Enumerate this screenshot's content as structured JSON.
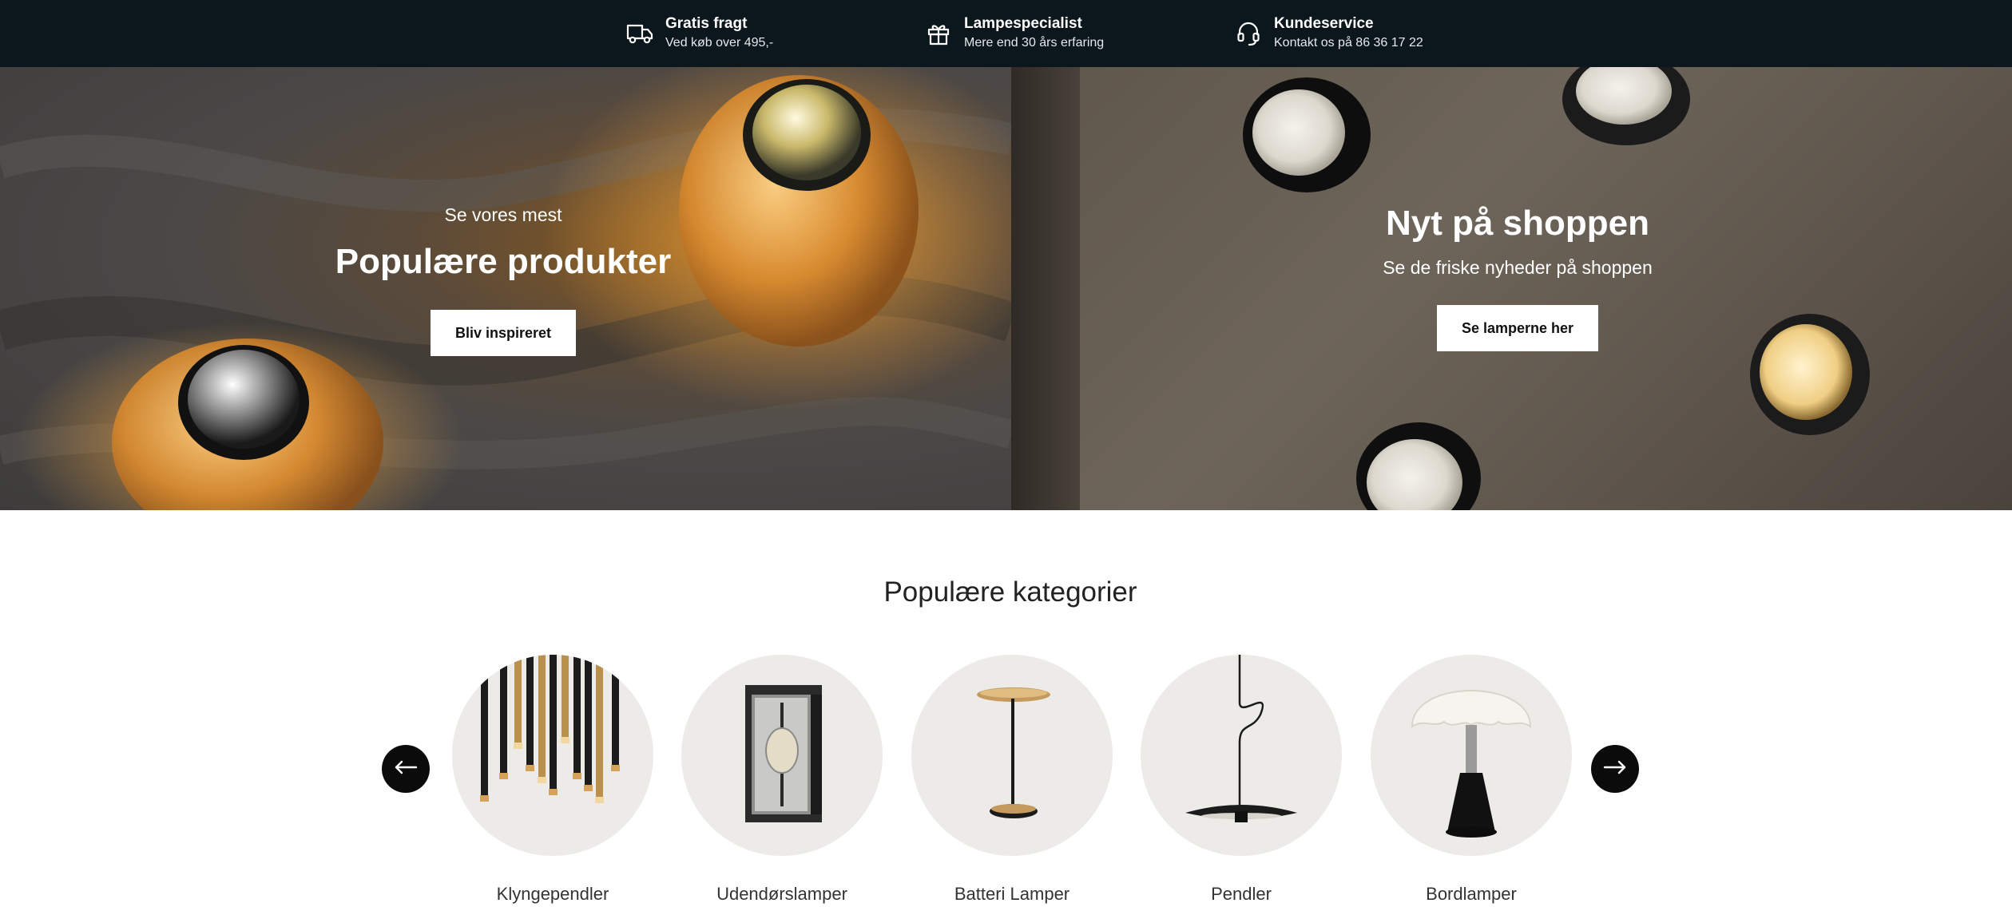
{
  "usp_bar": {
    "items": [
      {
        "icon": "truck-icon",
        "title": "Gratis fragt",
        "subtitle": "Ved køb over 495,-"
      },
      {
        "icon": "gift-icon",
        "title": "Lampespecialist",
        "subtitle": "Mere end 30 års erfaring"
      },
      {
        "icon": "headset-icon",
        "title": "Kundeservice",
        "subtitle": "Kontakt os på 86 36 17 22"
      }
    ]
  },
  "hero": {
    "left": {
      "kicker": "Se vores mest",
      "title": "Populære produkter",
      "button": "Bliv inspireret"
    },
    "right": {
      "title": "Nyt på shoppen",
      "subtitle": "Se de friske nyheder på shoppen",
      "button": "Se lamperne her"
    }
  },
  "categories": {
    "heading": "Populære kategorier",
    "items": [
      {
        "label": "Klyngependler"
      },
      {
        "label": "Udendørslamper"
      },
      {
        "label": "Batteri Lamper"
      },
      {
        "label": "Pendler"
      },
      {
        "label": "Bordlamper"
      }
    ],
    "prev_icon": "arrow-left-icon",
    "next_icon": "arrow-right-icon"
  },
  "colors": {
    "top_bar": "#0b161d",
    "button_bg": "#ffffff",
    "circle_bg": "#ecebe8",
    "arrow_bg": "#0b0b0b"
  }
}
